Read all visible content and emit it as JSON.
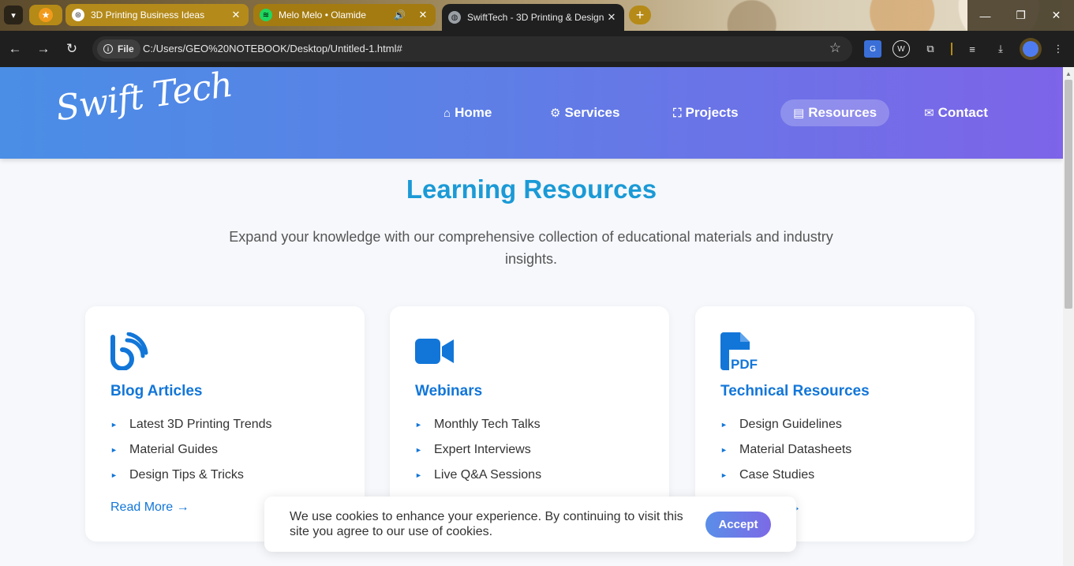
{
  "browser": {
    "pinned_tab": {
      "icon": "star-icon"
    },
    "tabs": [
      {
        "title": "3D Printing Business Ideas",
        "icon": "chatgpt-icon"
      },
      {
        "title": "Melo Melo • Olamide",
        "icon": "spotify-icon",
        "audio": "🔊"
      },
      {
        "title": "SwiftTech - 3D Printing & Design",
        "icon": "globe-icon"
      }
    ],
    "file_chip": "File",
    "url": "C:/Users/GEO%20NOTEBOOK/Desktop/Untitled-1.html#"
  },
  "site": {
    "logo": "Swift Tech",
    "nav": [
      {
        "label": "Home",
        "icon": "home-icon",
        "glyph": "⌂",
        "active": false
      },
      {
        "label": "Services",
        "icon": "gears-icon",
        "glyph": "⚙",
        "active": false
      },
      {
        "label": "Projects",
        "icon": "sitemap-icon",
        "glyph": "⛶",
        "active": false
      },
      {
        "label": "Resources",
        "icon": "book-icon",
        "glyph": "▤",
        "active": true
      },
      {
        "label": "Contact",
        "icon": "envelope-icon",
        "glyph": "✉",
        "active": false
      }
    ]
  },
  "main": {
    "title": "Learning Resources",
    "subtitle": "Expand your knowledge with our comprehensive collection of educational materials and industry insights."
  },
  "cards": [
    {
      "title": "Blog Articles",
      "icon": "blog-icon",
      "items": [
        "Latest 3D Printing Trends",
        "Material Guides",
        "Design Tips & Tricks"
      ],
      "link": "Read More →"
    },
    {
      "title": "Webinars",
      "icon": "video-icon",
      "items": [
        "Monthly Tech Talks",
        "Expert Interviews",
        "Live Q&A Sessions"
      ],
      "link": ""
    },
    {
      "title": "Technical Resources",
      "icon": "pdf-icon",
      "items": [
        "Design Guidelines",
        "Material Datasheets",
        "Case Studies"
      ],
      "link": "→"
    }
  ],
  "cookie": {
    "text": "We use cookies to enhance your experience. By continuing to visit this site you agree to our use of cookies.",
    "accept": "Accept"
  },
  "colors": {
    "accent": "#1276d8",
    "title": "#1b9ad6",
    "header_start": "#4a8ee6",
    "header_end": "#7d64e8"
  }
}
